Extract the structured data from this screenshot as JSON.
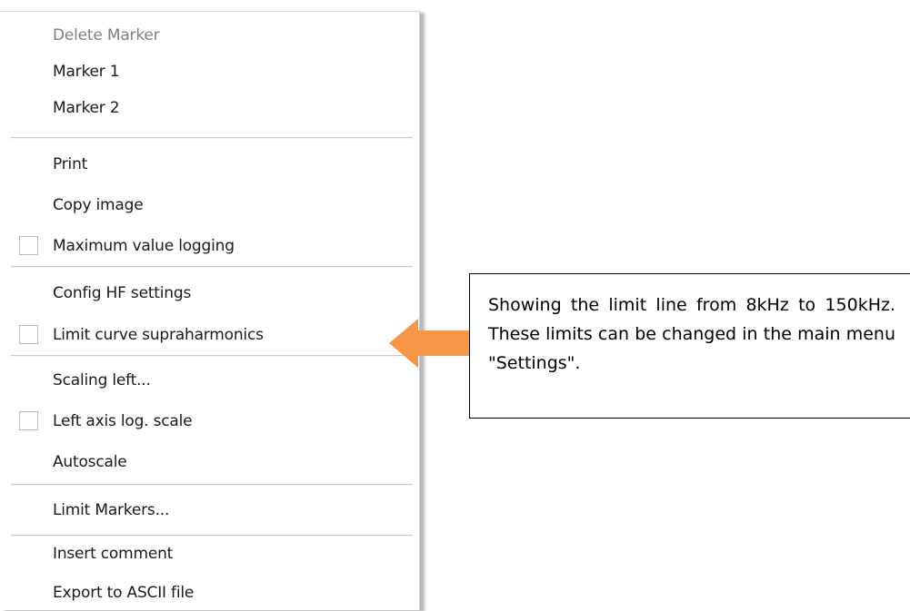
{
  "context_menu": {
    "items": [
      {
        "label": "Delete Marker",
        "disabled": true,
        "checkbox": false
      },
      {
        "label": "Marker 1",
        "disabled": false,
        "checkbox": false
      },
      {
        "label": "Marker 2",
        "disabled": false,
        "checkbox": false
      },
      {
        "label": "Print",
        "disabled": false,
        "checkbox": false
      },
      {
        "label": "Copy image",
        "disabled": false,
        "checkbox": false
      },
      {
        "label": "Maximum value logging",
        "disabled": false,
        "checkbox": true,
        "checked": false
      },
      {
        "label": "Config HF settings",
        "disabled": false,
        "checkbox": false
      },
      {
        "label": "Limit curve supraharmonics",
        "disabled": false,
        "checkbox": true,
        "checked": false
      },
      {
        "label": "Scaling left...",
        "disabled": false,
        "checkbox": false
      },
      {
        "label": "Left axis log. scale",
        "disabled": false,
        "checkbox": true,
        "checked": false
      },
      {
        "label": "Autoscale",
        "disabled": false,
        "checkbox": false
      },
      {
        "label": "Limit Markers...",
        "disabled": false,
        "checkbox": false
      },
      {
        "label": "Insert comment",
        "disabled": false,
        "checkbox": false
      },
      {
        "label": "Export to ASCII file",
        "disabled": false,
        "checkbox": false
      }
    ]
  },
  "annotation": {
    "text": "Showing the limit line from 8kHz to 150kHz. These limits can be changed in the main menu \"Settings\".",
    "arrow_color": "#f79646",
    "arrow_icon": "left-arrow-icon"
  },
  "colors": {
    "disabled_text": "#808080",
    "separator": "#c9c9c9",
    "checkbox_border": "#b9b9b9"
  }
}
